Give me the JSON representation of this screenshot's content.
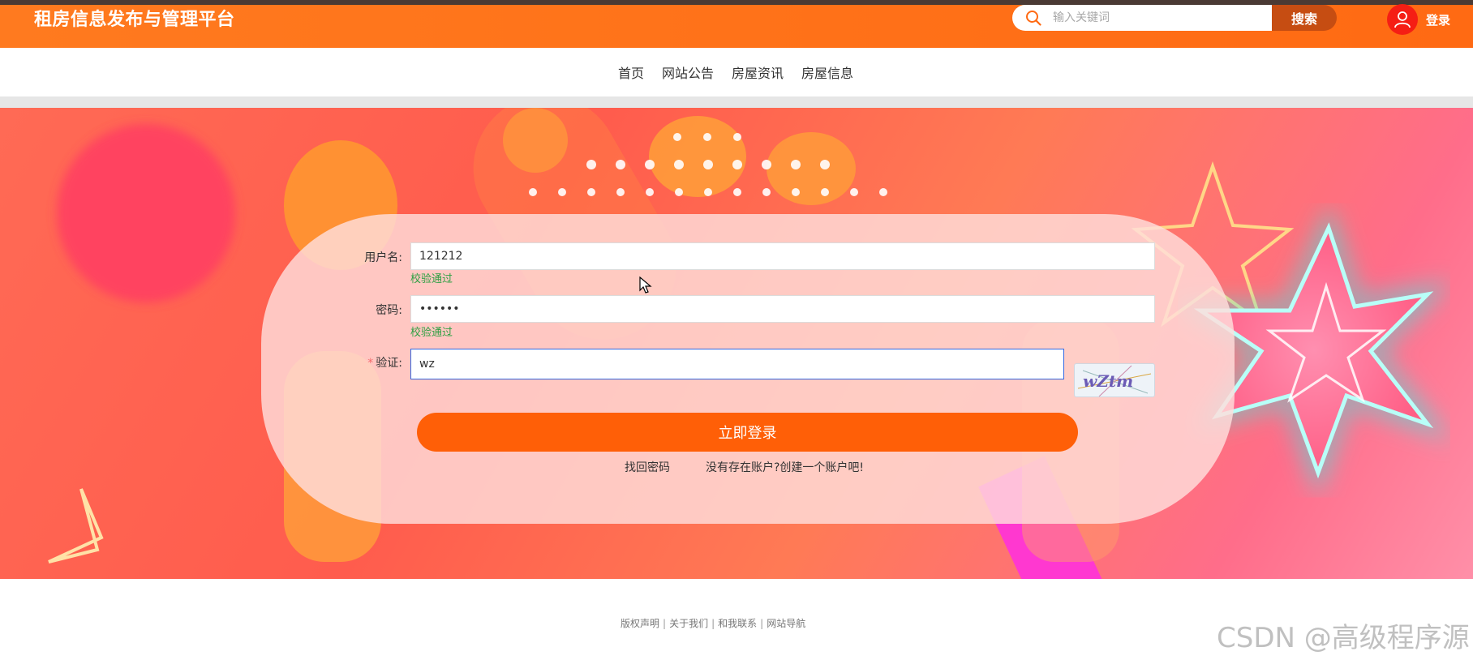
{
  "header": {
    "site_title": "租房信息发布与管理平台",
    "search_placeholder": "输入关键词",
    "search_button": "搜索",
    "login_label": "登录"
  },
  "nav": {
    "items": [
      "首页",
      "网站公告",
      "房屋资讯",
      "房屋信息"
    ]
  },
  "login_form": {
    "username_label": "用户名:",
    "username_value": "121212",
    "username_msg": "校验通过",
    "password_label": "密码:",
    "password_value": "••••••",
    "password_msg": "校验通过",
    "captcha_label": "验证:",
    "captcha_required": "*",
    "captcha_value": "wz",
    "captcha_image_text": "wZtm",
    "submit_label": "立即登录",
    "forgot_password": "找回密码",
    "register_link": "没有存在账户?创建一个账户吧!"
  },
  "footer": {
    "links": [
      "版权声明",
      "关于我们",
      "和我联系",
      "网站导航"
    ],
    "separator": "|",
    "watermark": "CSDN @高级程序源"
  },
  "colors": {
    "header_bg": "#ff6a13",
    "search_button_bg": "#c64d12",
    "avatar_bg": "#f51e14",
    "submit_bg": "#ff5f07",
    "valid_text": "#2ea043",
    "focus_border": "#3366e0"
  },
  "icons": {
    "search": "search-icon",
    "avatar": "user-icon",
    "cursor": "mouse-cursor-icon"
  }
}
